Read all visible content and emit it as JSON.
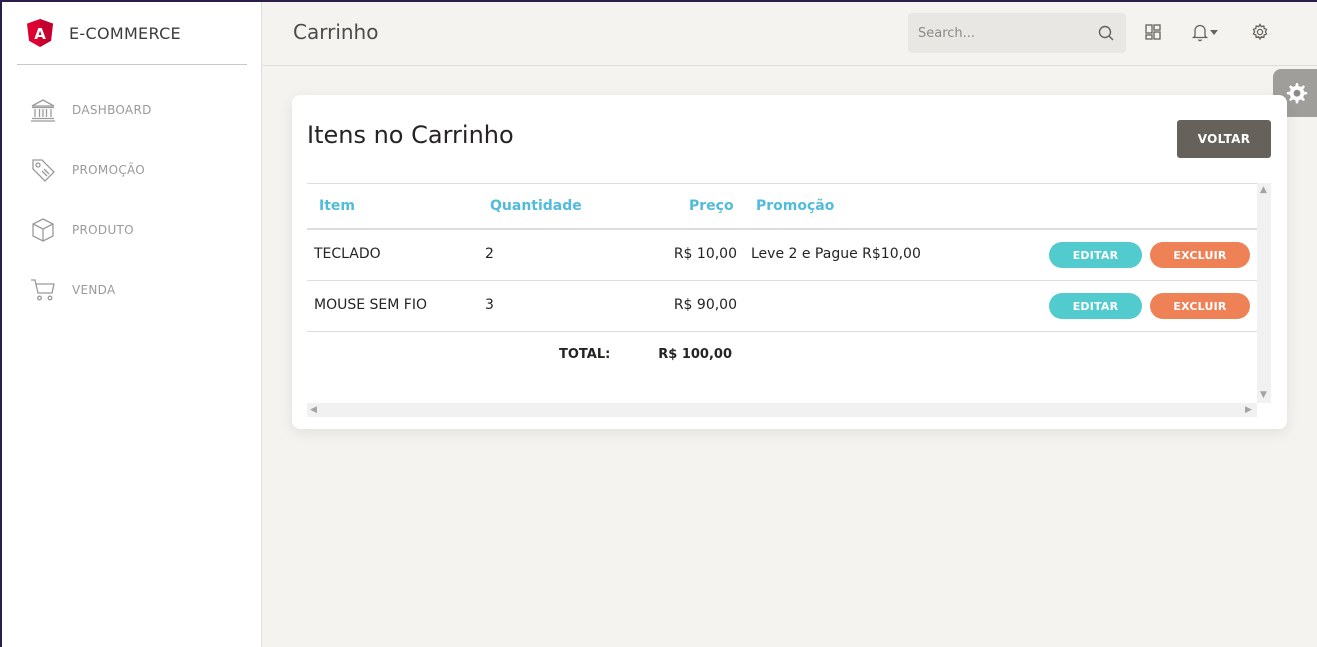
{
  "brand": {
    "name": "E-COMMERCE",
    "logo_letter": "A"
  },
  "sidebar": {
    "items": [
      {
        "label": "DASHBOARD",
        "icon": "bank-icon"
      },
      {
        "label": "PROMOÇÃO",
        "icon": "tag-icon"
      },
      {
        "label": "PRODUTO",
        "icon": "box-icon"
      },
      {
        "label": "VENDA",
        "icon": "cart-icon"
      }
    ]
  },
  "header": {
    "title": "Carrinho",
    "search_placeholder": "Search...",
    "icons": [
      "search-icon",
      "layout-grid-icon",
      "bell-icon",
      "gear-icon"
    ]
  },
  "card": {
    "title": "Itens no Carrinho",
    "back_label": "VOLTAR"
  },
  "table": {
    "headers": {
      "item": "Item",
      "quantity": "Quantidade",
      "price": "Preço",
      "promotion": "Promoção"
    },
    "rows": [
      {
        "item": "TECLADO",
        "quantity": "2",
        "price": "R$ 10,00",
        "promotion": "Leve 2 e Pague R$10,00",
        "edit": "EDITAR",
        "delete": "EXCLUIR"
      },
      {
        "item": "MOUSE SEM FIO",
        "quantity": "3",
        "price": "R$ 90,00",
        "promotion": "",
        "edit": "EDITAR",
        "delete": "EXCLUIR"
      }
    ],
    "total_label": "TOTAL:",
    "total_value": "R$ 100,00"
  },
  "colors": {
    "accent_info": "#51cbce",
    "header_text": "#51bcda",
    "danger": "#ef8157",
    "dark_button": "#66615b",
    "brand_red": "#dd0031"
  }
}
